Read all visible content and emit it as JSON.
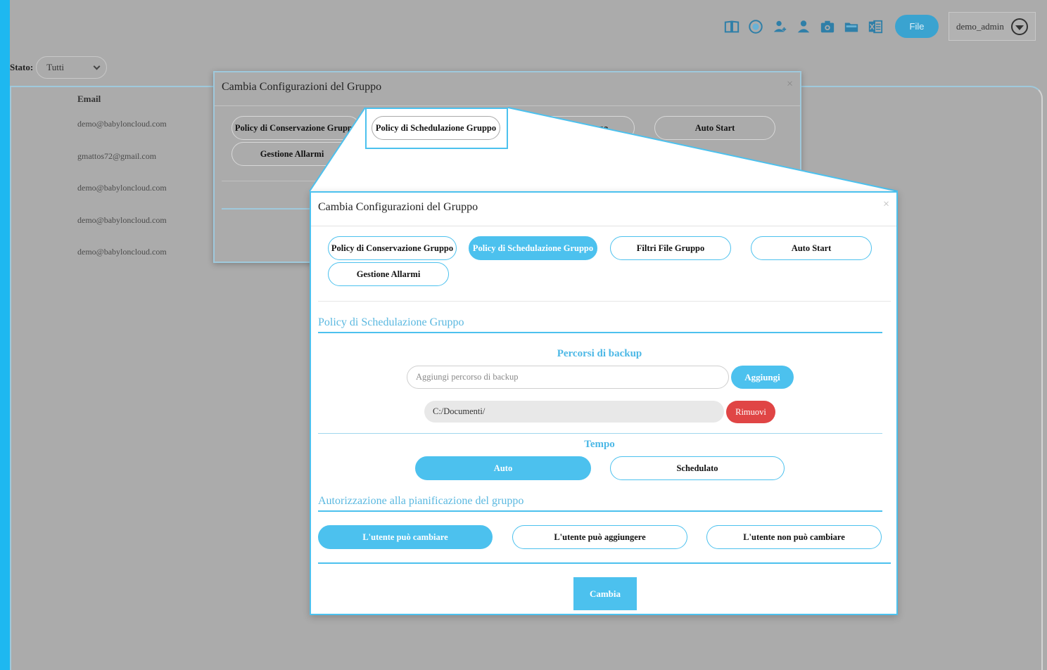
{
  "topbar": {
    "icons": [
      "book-icon",
      "globe-icon",
      "add-user-icon",
      "user-icon",
      "camera-icon",
      "folder-icon",
      "spreadsheet-icon"
    ],
    "file_label": "File",
    "user_label": "demo_admin"
  },
  "filter": {
    "label": "Stato:",
    "value": "Tutti"
  },
  "table": {
    "email_header": "Email",
    "emails": [
      "demo@babyloncloud.com",
      "gmattos72@gmail.com",
      "demo@babyloncloud.com",
      "demo@babyloncloud.com",
      "demo@babyloncloud.com"
    ]
  },
  "modal": {
    "title": "Cambia Configurazioni del Gruppo",
    "close": "×",
    "tabs": [
      "Policy di Conservazione Gruppo",
      "Policy di Schedulazione Gruppo",
      "Filtri File Gruppo",
      "Auto Start",
      "Gestione Allarmi"
    ],
    "active_tab_index": 1,
    "section_title": "Policy di Schedulazione Gruppo",
    "backup": {
      "title": "Percorsi di backup",
      "placeholder": "Aggiungi percorso di backup",
      "add_label": "Aggiungi",
      "paths": [
        "C:/Documenti/"
      ],
      "remove_label": "Rimuovi"
    },
    "tempo": {
      "title": "Tempo",
      "options": [
        "Auto",
        "Schedulato"
      ],
      "selected": "Auto"
    },
    "authorization": {
      "title": "Autorizzazione alla pianificazione del gruppo",
      "options": [
        "L'utente può cambiare",
        "L'utente può aggiungere",
        "L'utente non può cambiare"
      ],
      "selected": "L'utente può cambiare"
    },
    "submit_label": "Cambia"
  },
  "colors": {
    "accent": "#4cc1ee",
    "danger": "#e04545",
    "overlay": "#ababab"
  }
}
